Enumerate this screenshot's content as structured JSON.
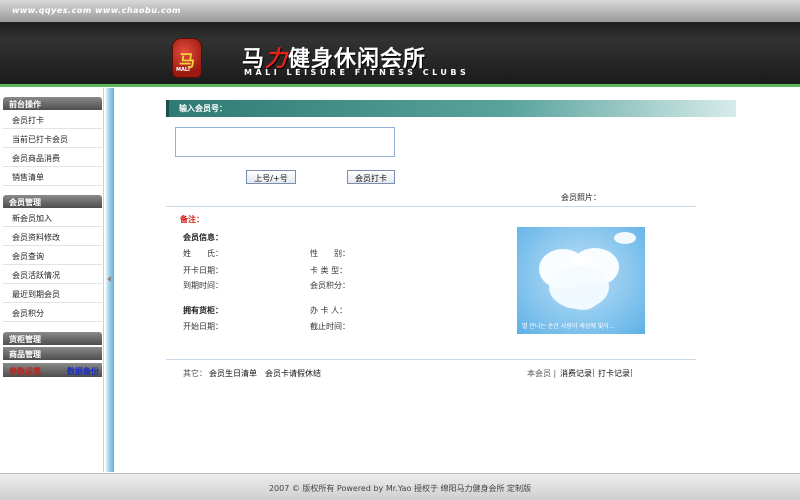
{
  "header": {
    "url_text": "www.qqyes.com  www.chaobu.com",
    "brand_cn_first": "马",
    "brand_cn_second": "力",
    "brand_cn_rest": "健身休闲会所",
    "brand_en": "MALI LEISURE FITNESS CLUBS",
    "logo_glyph": "马",
    "logo_small": "MALI",
    "accent_color": "#5cb85c"
  },
  "sidebar": {
    "groups": [
      {
        "title": "前台操作",
        "items": [
          "会员打卡",
          "当前已打卡会员",
          "会员商品消费",
          "销售清单"
        ]
      },
      {
        "title": "会员管理",
        "items": [
          "新会员加入",
          "会员资料修改",
          "会员查询",
          "会员活跃情况",
          "最近到期会员",
          "会员积分"
        ]
      },
      {
        "title": "货柜管理",
        "items": []
      },
      {
        "title": "商品管理",
        "items": []
      }
    ],
    "bottom_links": [
      "参数设置",
      "数据备份"
    ]
  },
  "main": {
    "title": "输入会员号：",
    "input_value": "",
    "buttons": {
      "next": "上号/+号",
      "checkin": "会员打卡"
    },
    "photo_label": "会员照片：",
    "remark_label": "备注：",
    "member_info_title": "会员信息：",
    "fields_left": [
      "姓　　氏：",
      "开卡日期：",
      "到期时间："
    ],
    "fields_right": [
      "性　　别：",
      "卡 类 型：",
      "会员积分："
    ],
    "cabinet_title": "拥有货柜：",
    "cabinet_left": [
      "开始日期："
    ],
    "cabinet_right": [
      "办 卡 人：",
      "截止时间："
    ],
    "other_label": "其它：",
    "other_links": [
      "会员生日清单",
      "会员卡请假休结"
    ],
    "this_member": "本会员 |",
    "member_links": [
      "消费记录",
      "打卡记录"
    ],
    "photo_caption": "별 만나는 순간  사랑이 세상에 빛이..."
  },
  "footer": {
    "text": "2007 © 版权所有  Powered by Mr.Yao  授权于  绵阳马力健身会所  定制版"
  }
}
